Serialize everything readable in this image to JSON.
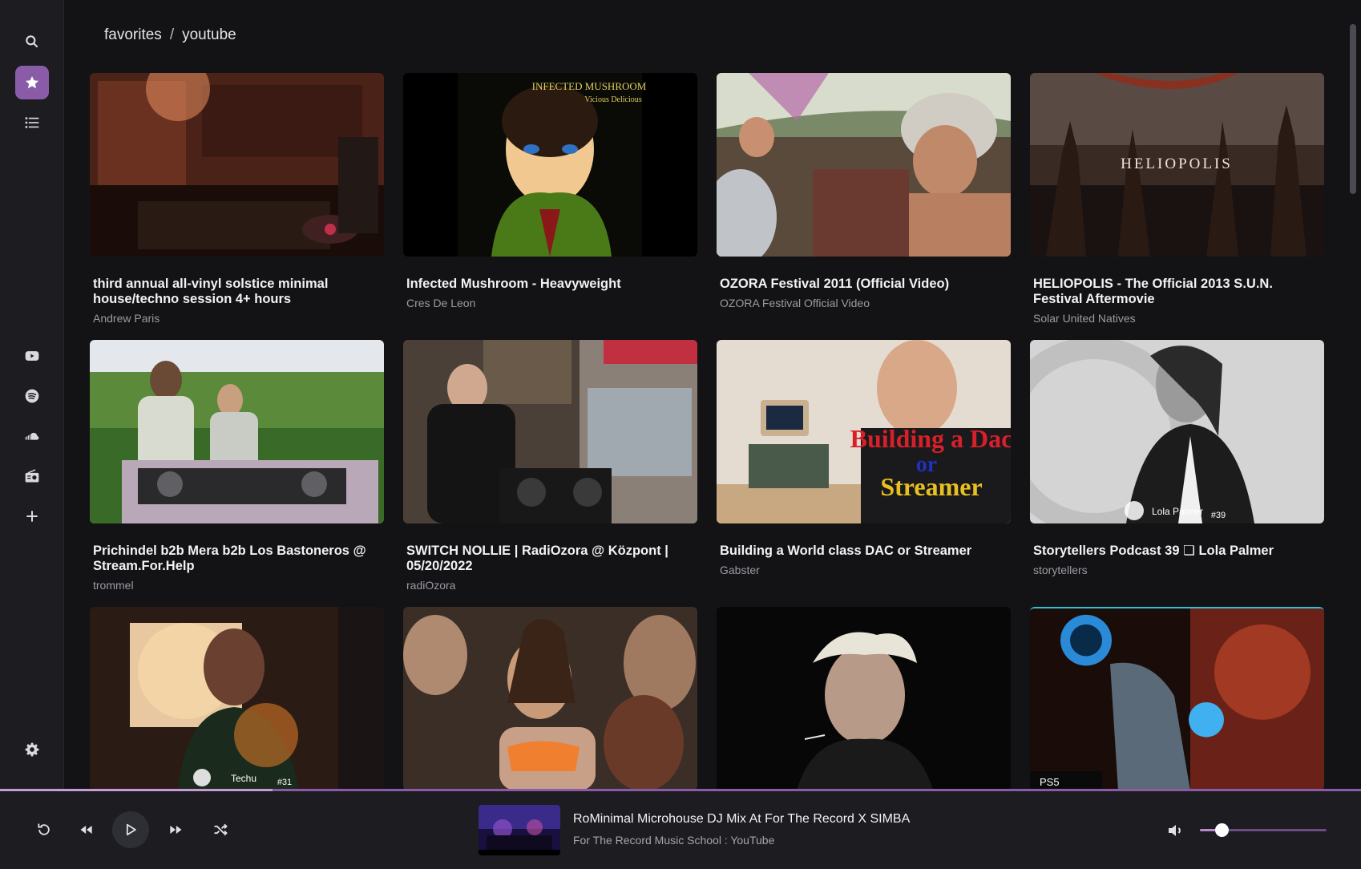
{
  "sidebar": {
    "top": [
      {
        "name": "search-icon",
        "active": false
      },
      {
        "name": "star-icon",
        "active": true
      },
      {
        "name": "list-icon",
        "active": false
      }
    ],
    "sources": [
      {
        "name": "youtube-icon"
      },
      {
        "name": "spotify-icon"
      },
      {
        "name": "soundcloud-icon"
      },
      {
        "name": "radio-icon"
      },
      {
        "name": "plus-icon"
      }
    ],
    "bottom": {
      "name": "gear-icon"
    }
  },
  "breadcrumb": {
    "root": "favorites",
    "separator": "/",
    "current": "youtube"
  },
  "cards": [
    {
      "title": "third annual all-vinyl solstice minimal house/techno session 4+ hours",
      "channel": "Andrew Paris",
      "palette": [
        "#3a1a14",
        "#b5502f",
        "#1a0e0a"
      ]
    },
    {
      "title": "Infected Mushroom - Heavyweight",
      "channel": "Cres De Leon",
      "palette": [
        "#000000",
        "#3c5a10",
        "#d8c050"
      ],
      "overlay": "INFECTED MUSHROOM",
      "overlay2": "Vicious Delicious"
    },
    {
      "title": "OZORA Festival 2011 (Official Video)",
      "channel": "OZORA Festival Official Video",
      "palette": [
        "#6b7a58",
        "#c9a088",
        "#d5d8c8"
      ]
    },
    {
      "title": "HELIOPOLIS - The Official 2013 S.U.N. Festival Aftermovie",
      "channel": "Solar United Natives",
      "palette": [
        "#2a1e1a",
        "#5a4036",
        "#0e0a08"
      ],
      "overlay": "HELIOPOLIS"
    },
    {
      "title": "Prichindel b2b Mera b2b Los Bastoneros @ Stream.For.Help",
      "channel": "trommel",
      "palette": [
        "#e8ecf0",
        "#4a7a30",
        "#2a2a2a"
      ]
    },
    {
      "title": "SWITCH NOLLIE | RadiOzora @ Központ | 05/20/2022",
      "channel": "radiOzora",
      "palette": [
        "#5a4a3c",
        "#1a1a1a",
        "#c9b070"
      ]
    },
    {
      "title": "Building a World class DAC or Streamer",
      "channel": "Gabster",
      "palette": [
        "#e8e0d8",
        "#1a1a1c",
        "#c89a70"
      ],
      "overlay": "Building a Dac",
      "overlay2": "or",
      "overlay3": "Streamer"
    },
    {
      "title": "Storytellers Podcast 39 ❏ Lola Palmer",
      "channel": "storytellers",
      "palette": [
        "#d8d8d8",
        "#8a8a8a",
        "#1a1a1a"
      ],
      "overlay": "Lola Palmer",
      "overlay2": "#39"
    },
    {
      "title": "",
      "channel": "",
      "palette": [
        "#3a2418",
        "#d88a50",
        "#101010"
      ],
      "overlay": "Techu",
      "overlay2": "#31"
    },
    {
      "title": "",
      "channel": "",
      "palette": [
        "#4a3a30",
        "#d87a40",
        "#1a1612"
      ]
    },
    {
      "title": "",
      "channel": "",
      "palette": [
        "#0a0a0a",
        "#1a1a18",
        "#c8c4b0"
      ]
    },
    {
      "title": "",
      "channel": "",
      "palette": [
        "#1a0a06",
        "#b8402a",
        "#2a6ab8"
      ],
      "overlay": "PS5"
    }
  ],
  "player": {
    "progress": 0.2,
    "volume": 0.17,
    "track_title": "RoMinimal Microhouse DJ Mix At For The Record X SIMBA",
    "track_source": "For The Record Music School : YouTube",
    "controls": [
      "repeat-icon",
      "previous-icon",
      "play-icon",
      "next-icon",
      "shuffle-icon"
    ],
    "volume_icon": "volume-icon"
  },
  "colors": {
    "accent": "#8a5ca8",
    "background": "#131316",
    "panel": "#1c1c21"
  }
}
